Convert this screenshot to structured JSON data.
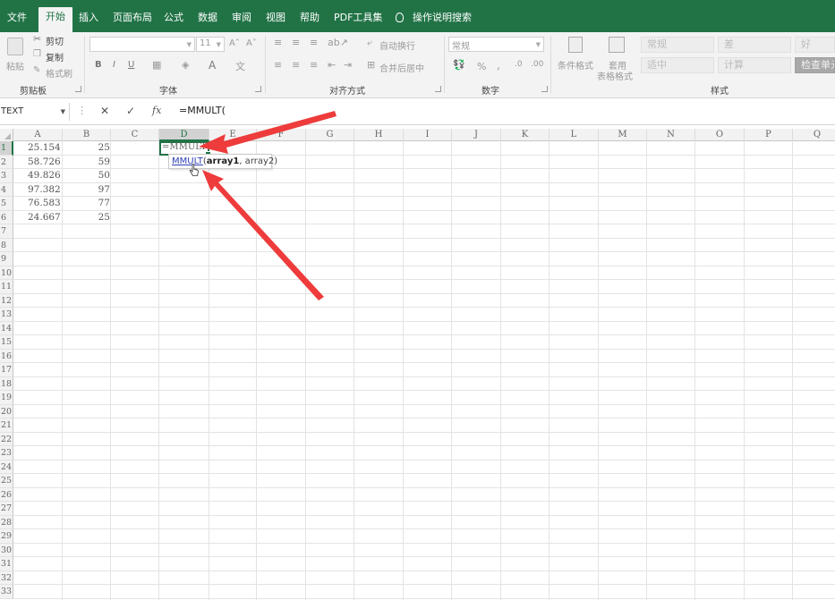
{
  "tabs": [
    {
      "label": "文件",
      "active": false
    },
    {
      "label": "开始",
      "active": true
    },
    {
      "label": "插入",
      "active": false
    },
    {
      "label": "页面布局",
      "active": false
    },
    {
      "label": "公式",
      "active": false
    },
    {
      "label": "数据",
      "active": false
    },
    {
      "label": "审阅",
      "active": false
    },
    {
      "label": "视图",
      "active": false
    },
    {
      "label": "帮助",
      "active": false
    },
    {
      "label": "PDF工具集",
      "active": false
    }
  ],
  "tell_me": "操作说明搜索",
  "ribbon": {
    "clipboard": {
      "label": "剪贴板",
      "paste": "粘贴",
      "cut": "剪切",
      "copy": "复制",
      "format_painter": "格式刷"
    },
    "font": {
      "label": "字体",
      "size": "11",
      "bold": "B",
      "italic": "I",
      "underline": "U",
      "font_color": "A"
    },
    "alignment": {
      "label": "对齐方式",
      "wrap": "自动换行",
      "merge": "合并后居中"
    },
    "number": {
      "label": "数字",
      "format": "常规",
      "percent": "%",
      "comma": ","
    },
    "styles": {
      "label": "样式",
      "conditional": "条件格式",
      "table_fmt_1": "套用",
      "table_fmt_2": "表格格式",
      "normal": "常规",
      "bad": "差",
      "good": "好",
      "neutral": "适中",
      "calculation": "计算",
      "check_cell": "检查单元格"
    }
  },
  "formula_bar": {
    "name_box": "TEXT",
    "cancel": "✕",
    "enter": "✓",
    "fx": "fx",
    "formula": "=MMULT("
  },
  "sheet": {
    "columns": [
      "A",
      "B",
      "C",
      "D",
      "E",
      "F",
      "G",
      "H",
      "I",
      "J",
      "K",
      "L",
      "M",
      "N",
      "O",
      "P",
      "Q"
    ],
    "rows": [
      "1",
      "2",
      "3",
      "4",
      "5",
      "6",
      "7",
      "8",
      "9",
      "10",
      "11",
      "12",
      "13",
      "14",
      "15",
      "16",
      "17",
      "18",
      "19",
      "20",
      "21",
      "22",
      "23",
      "24",
      "25",
      "26",
      "27",
      "28",
      "29",
      "30",
      "31",
      "32",
      "33"
    ],
    "col_a": [
      "25.154",
      "58.726",
      "49.826",
      "97.382",
      "76.583",
      "24.667"
    ],
    "col_b": [
      "25",
      "59",
      "50",
      "97",
      "77",
      "25"
    ],
    "active_cell": "D1",
    "cell_edit_text": "=MMULT("
  },
  "tooltip": {
    "fn": "MMULT",
    "open": "(",
    "arg1": "array1",
    "rest": ", array2)"
  },
  "colors": {
    "accent": "#217346",
    "arrow": "#ee3b3b"
  }
}
